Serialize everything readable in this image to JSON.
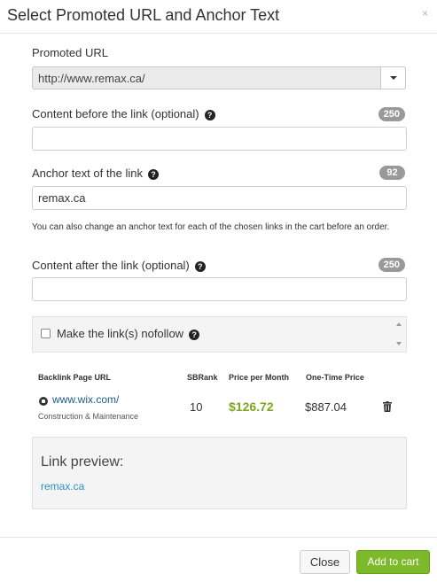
{
  "dialog": {
    "title": "Select Promoted URL and Anchor Text",
    "close_glyph": "×"
  },
  "promoted_url": {
    "label": "Promoted URL",
    "value": "http://www.remax.ca/"
  },
  "content_before": {
    "label": "Content before the link (optional)",
    "counter": "250",
    "value": ""
  },
  "anchor_text": {
    "label": "Anchor text of the link",
    "counter": "92",
    "value": "remax.ca",
    "hint": "You can also change an anchor text for each of the chosen links in the cart before an order."
  },
  "content_after": {
    "label": "Content after the link (optional)",
    "counter": "250",
    "value": ""
  },
  "nofollow": {
    "label": "Make the link(s) nofollow",
    "checked": false
  },
  "table": {
    "headers": [
      "Backlink Page URL",
      "SBRank",
      "Price per Month",
      "One-Time Price"
    ],
    "rows": [
      {
        "url": "www.wix.com/",
        "category": "Construction & Maintenance",
        "sbrank": "10",
        "price_month": "$126.72",
        "price_once": "$887.04"
      }
    ]
  },
  "preview": {
    "title": "Link preview:",
    "link_text": "remax.ca"
  },
  "footer": {
    "close_label": "Close",
    "add_label": "Add to cart"
  },
  "colors": {
    "accent_green": "#7dba2a",
    "price_green": "#7da621",
    "link_blue": "#2b92c8",
    "badge_gray": "#999999"
  },
  "icons": [
    "close-icon",
    "help-icon",
    "caret-down-icon",
    "site-icon",
    "trash-icon",
    "scroll-up-icon",
    "scroll-down-icon"
  ]
}
